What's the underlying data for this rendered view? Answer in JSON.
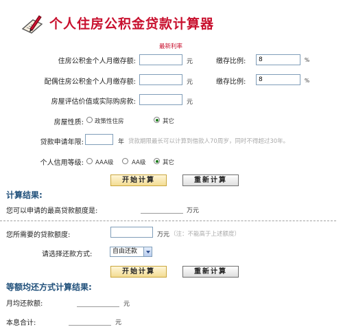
{
  "header": {
    "title": "个人住房公积金贷款计算器",
    "latest_rate_link": "最新利率"
  },
  "form": {
    "personal_deposit": {
      "label": "住房公积金个人月缴存额:",
      "value": "",
      "unit": "元"
    },
    "personal_ratio": {
      "label": "缴存比例:",
      "value": "8",
      "unit": "%"
    },
    "spouse_deposit": {
      "label": "配偶住房公积金个人月缴存额:",
      "value": "",
      "unit": "元"
    },
    "spouse_ratio": {
      "label": "缴存比例:",
      "value": "8",
      "unit": "%"
    },
    "house_value": {
      "label": "房屋评估价值或实际购房款:",
      "value": "",
      "unit": "元"
    },
    "house_type": {
      "label": "房屋性质:",
      "options": [
        "政策性住房",
        "其它"
      ],
      "selected": "其它"
    },
    "loan_years": {
      "label": "贷款申请年限:",
      "value": "",
      "unit": "年",
      "hint": "贷款期限最长可以计算到借款人70周岁，同时不得超过30年。"
    },
    "credit_level": {
      "label": "个人信用等级:",
      "options": [
        "AAA级",
        "AA级",
        "其它"
      ],
      "selected": "其它"
    },
    "start_button": "开始计算",
    "reset_button": "重新计算"
  },
  "results": {
    "heading": "计算结果:",
    "max_loan_label": "您可以申请的最高贷款额度是:",
    "max_loan_unit": "万元"
  },
  "loan_form": {
    "needed_label": "您所需要的贷款额度:",
    "needed_value": "",
    "needed_unit": "万元",
    "needed_note": "（注：不能高于上述额度）",
    "repay_label": "请选择还款方式:",
    "repay_selected": "自由还款",
    "start_button": "开始计算",
    "reset_button": "重新计算"
  },
  "equal_results": {
    "heading": "等额均还方式计算结果:",
    "monthly_label": "月均还款额:",
    "monthly_unit": "元",
    "total_label": "本息合计:",
    "total_unit": "元"
  }
}
